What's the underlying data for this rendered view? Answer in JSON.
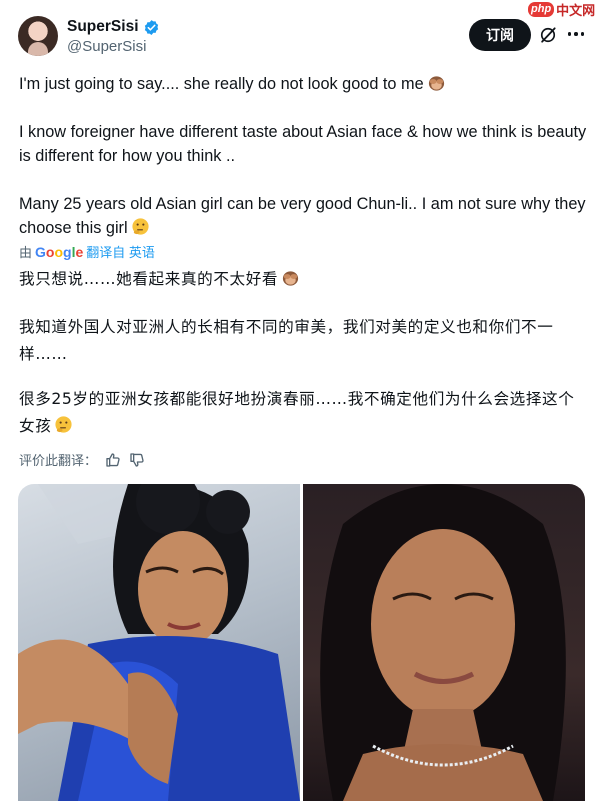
{
  "author": {
    "name": "SuperSisi",
    "handle": "@SuperSisi"
  },
  "actions": {
    "subscribe_label": "订阅"
  },
  "watermark": {
    "logo": "php",
    "text": "中文网"
  },
  "tweet": {
    "en_p1": "I'm just going to say.... she really do not look good to me",
    "en_p2": "I know foreigner have different taste about Asian face & how we think is beauty is different for how you think ..",
    "en_p3": "Many 25 years old Asian girl can be very good Chun-li.. I am not sure why they choose this girl",
    "zh_p1": "我只想说……她看起来真的不太好看",
    "zh_p2": "我知道外国人对亚洲人的长相有不同的审美，我们对美的定义也和你们不一样……",
    "zh_p3": "很多25岁的亚洲女孩都能很好地扮演春丽……我不确定他们为什么会选择这个女孩"
  },
  "translation": {
    "by": "由",
    "google": "Google",
    "translated_from": "翻译自 英语",
    "rate_label": "评价此翻译："
  },
  "icons": {
    "verified": "verified-badge-icon",
    "emoji_monkey": "see-no-evil-monkey-emoji",
    "emoji_thinking": "thinking-face-emoji",
    "grok": "grok-icon",
    "more": "more-icon",
    "thumbs_up": "thumbs-up-icon",
    "thumbs_down": "thumbs-down-icon"
  },
  "colors": {
    "accent": "#1d9bf0",
    "text": "#0f1419",
    "muted": "#536471",
    "button_bg": "#0f1419"
  }
}
